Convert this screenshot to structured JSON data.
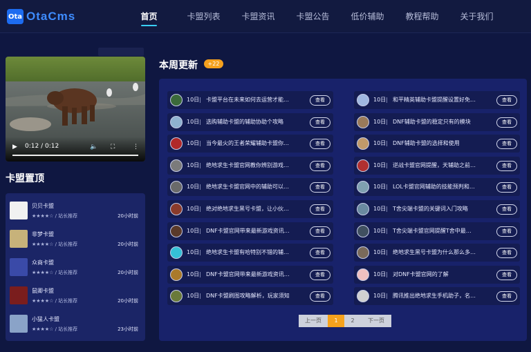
{
  "brand": {
    "logo_mark": "Ota",
    "logo_text": "OtaCms"
  },
  "nav": {
    "items": [
      {
        "label": "首页",
        "active": true
      },
      {
        "label": "卡盟列表"
      },
      {
        "label": "卡盟资讯"
      },
      {
        "label": "卡盟公告"
      },
      {
        "label": "低价辅助"
      },
      {
        "label": "教程帮助"
      },
      {
        "label": "关于我们"
      }
    ]
  },
  "video": {
    "time": "0:12 / 0:12",
    "play_icon": "play-icon",
    "volume_icon": "volume-icon",
    "fullscreen_icon": "fullscreen-icon",
    "more_icon": "more-icon",
    "progress": 1.0
  },
  "ranking": {
    "title": "卡盟置顶",
    "items": [
      {
        "name": "贝贝卡盟",
        "rating": "★★★★☆ / 站长推荐",
        "time": "20小时前"
      },
      {
        "name": "非梦卡盟",
        "rating": "★★★★☆ / 站长推荐",
        "time": "20小时前"
      },
      {
        "name": "众商卡盟",
        "rating": "★★★★☆ / 站长推荐",
        "time": "20小时前"
      },
      {
        "name": "鼠卿卡盟",
        "rating": "★★★★☆ / 站长推荐",
        "time": "20小时前"
      },
      {
        "name": "小猛人卡盟",
        "rating": "★★★★☆ / 站长推荐",
        "time": "23小时前"
      }
    ]
  },
  "weekly": {
    "title": "本周更新",
    "badge": "+22",
    "left": [
      {
        "day": "10日",
        "sep": "|",
        "title": "卡盟平台在未来如何去运营才能…",
        "btn": "查看"
      },
      {
        "day": "10日",
        "sep": "|",
        "title": "选购辅助卡盟的辅助协助个攻略",
        "btn": "查看"
      },
      {
        "day": "10日",
        "sep": "|",
        "title": "当今最火的王者荣耀辅助卡盟你…",
        "btn": "查看"
      },
      {
        "day": "10日",
        "sep": "|",
        "title": "绝地求生卡盟官网教你辨别游戏…",
        "btn": "查看"
      },
      {
        "day": "10日",
        "sep": "|",
        "title": "绝地求生卡盟官网中的辅助可以…",
        "btn": "查看"
      },
      {
        "day": "10日",
        "sep": "|",
        "title": "绝对绝地求生黑号卡盟，让小伙…",
        "btn": "查看"
      },
      {
        "day": "10日",
        "sep": "|",
        "title": "DNF卡盟官网带来最新游戏资讯…",
        "btn": "查看"
      },
      {
        "day": "10日",
        "sep": "|",
        "title": "绝地求生卡盟有哈特别不错的辅…",
        "btn": "查看"
      },
      {
        "day": "10日",
        "sep": "|",
        "title": "DNF卡盟官网带来最新游戏资讯…",
        "btn": "查看"
      },
      {
        "day": "10日",
        "sep": "|",
        "title": "DNF卡盟刷图攻略解析，玩家须知",
        "btn": "查看"
      }
    ],
    "right": [
      {
        "day": "10日",
        "sep": "|",
        "title": "和平精英辅助卡盟提醒设置好免…",
        "btn": "查看"
      },
      {
        "day": "10日",
        "sep": "|",
        "title": "DNF辅助卡盟的稳定只有的模块",
        "btn": "查看"
      },
      {
        "day": "10日",
        "sep": "|",
        "title": "DNF辅助卡盟的选择和使用",
        "btn": "查看"
      },
      {
        "day": "10日",
        "sep": "|",
        "title": "逆战卡盟官网提醒，天辅助之前…",
        "btn": "查看"
      },
      {
        "day": "10日",
        "sep": "|",
        "title": "LOL卡盟官网辅助的技能预判和…",
        "btn": "查看"
      },
      {
        "day": "10日",
        "sep": "|",
        "title": "T舍尖端卡盟的关键词入门攻略",
        "btn": "查看"
      },
      {
        "day": "10日",
        "sep": "|",
        "title": "T舍尖端卡盟官网提醒T舍中最…",
        "btn": "查看"
      },
      {
        "day": "10日",
        "sep": "|",
        "title": "绝地求生黑号卡盟为什么那么多…",
        "btn": "查看"
      },
      {
        "day": "10日",
        "sep": "|",
        "title": "对DNF卡盟官网的了解",
        "btn": "查看"
      },
      {
        "day": "10日",
        "sep": "|",
        "title": "腾讯推出绝地求生手机助子，名…",
        "btn": "查看"
      }
    ]
  },
  "pagination": {
    "prev": "上一页",
    "pages": [
      "1",
      "2"
    ],
    "current": "1",
    "next": "下一页"
  }
}
